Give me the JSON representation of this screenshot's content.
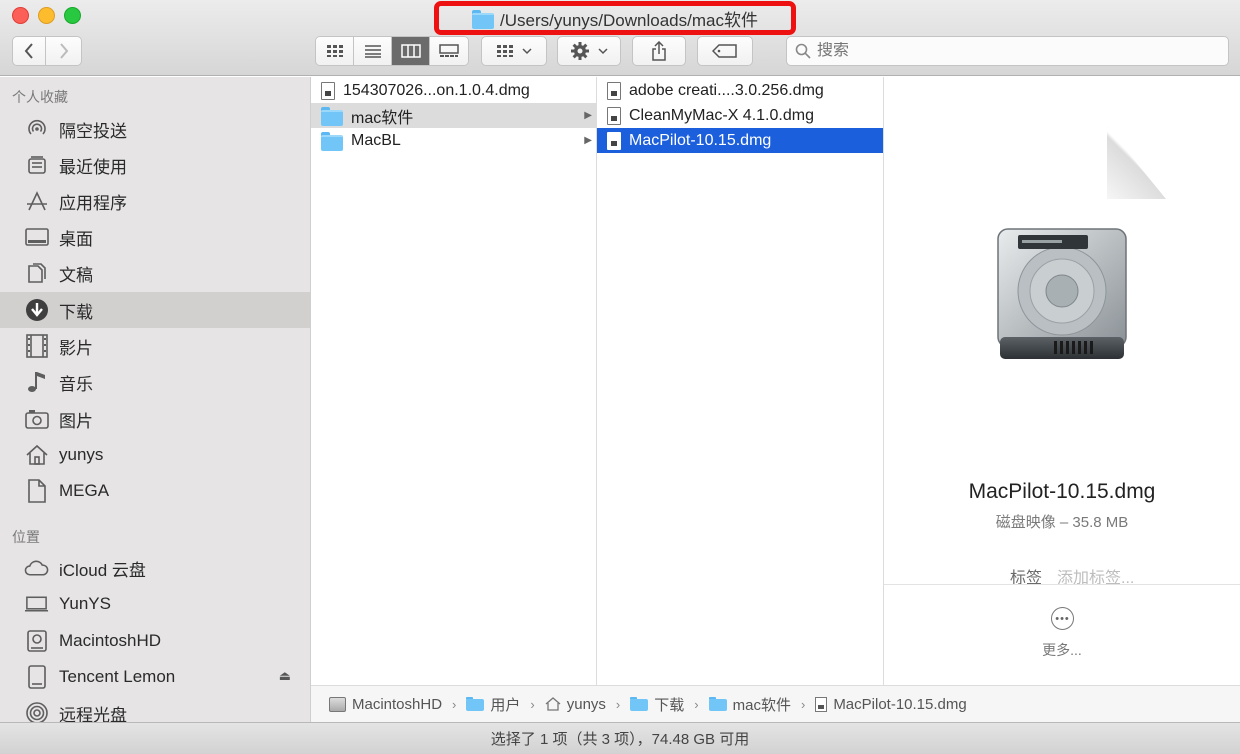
{
  "window": {
    "title": "/Users/yunys/Downloads/mac软件"
  },
  "toolbar": {
    "search_placeholder": "搜索"
  },
  "sidebar": {
    "favorites_header": "个人收藏",
    "favorites": [
      {
        "label": "隔空投送",
        "icon": "airdrop-icon"
      },
      {
        "label": "最近使用",
        "icon": "recents-icon"
      },
      {
        "label": "应用程序",
        "icon": "applications-icon"
      },
      {
        "label": "桌面",
        "icon": "desktop-icon"
      },
      {
        "label": "文稿",
        "icon": "documents-icon"
      },
      {
        "label": "下载",
        "icon": "downloads-icon",
        "selected": true
      },
      {
        "label": "影片",
        "icon": "movies-icon"
      },
      {
        "label": "音乐",
        "icon": "music-icon"
      },
      {
        "label": "图片",
        "icon": "pictures-icon"
      },
      {
        "label": "yunys",
        "icon": "home-icon"
      },
      {
        "label": "MEGA",
        "icon": "document-icon"
      }
    ],
    "locations_header": "位置",
    "locations": [
      {
        "label": "iCloud 云盘",
        "icon": "cloud-icon"
      },
      {
        "label": "YunYS",
        "icon": "laptop-icon"
      },
      {
        "label": "MacintoshHD",
        "icon": "hard-drive-icon"
      },
      {
        "label": "Tencent Lemon",
        "icon": "external-drive-icon"
      },
      {
        "label": "远程光盘",
        "icon": "remote-disc-icon"
      }
    ]
  },
  "columns": {
    "col1": [
      {
        "name": "154307026...on.1.0.4.dmg",
        "kind": "file"
      },
      {
        "name": "mac软件",
        "kind": "folder",
        "state": "selected-inactive"
      },
      {
        "name": "MacBL",
        "kind": "folder"
      }
    ],
    "col2": [
      {
        "name": "adobe creati....3.0.256.dmg",
        "kind": "file"
      },
      {
        "name": "CleanMyMac-X 4.1.0.dmg",
        "kind": "file"
      },
      {
        "name": "MacPilot-10.15.dmg",
        "kind": "file",
        "state": "selected"
      }
    ]
  },
  "preview": {
    "name": "MacPilot-10.15.dmg",
    "kind": "磁盘映像 – 35.8 MB",
    "tags_label": "标签",
    "tags_placeholder": "添加标签...",
    "more_label": "更多..."
  },
  "pathbar": [
    "MacintoshHD",
    "用户",
    "yunys",
    "下载",
    "mac软件",
    "MacPilot-10.15.dmg"
  ],
  "status": {
    "text": "选择了 1 项（共 3 项），74.48 GB 可用"
  },
  "colors": {
    "selection_blue": "#1b5fdc",
    "folder_blue": "#71c6f7",
    "highlight_red": "#ee1111"
  }
}
